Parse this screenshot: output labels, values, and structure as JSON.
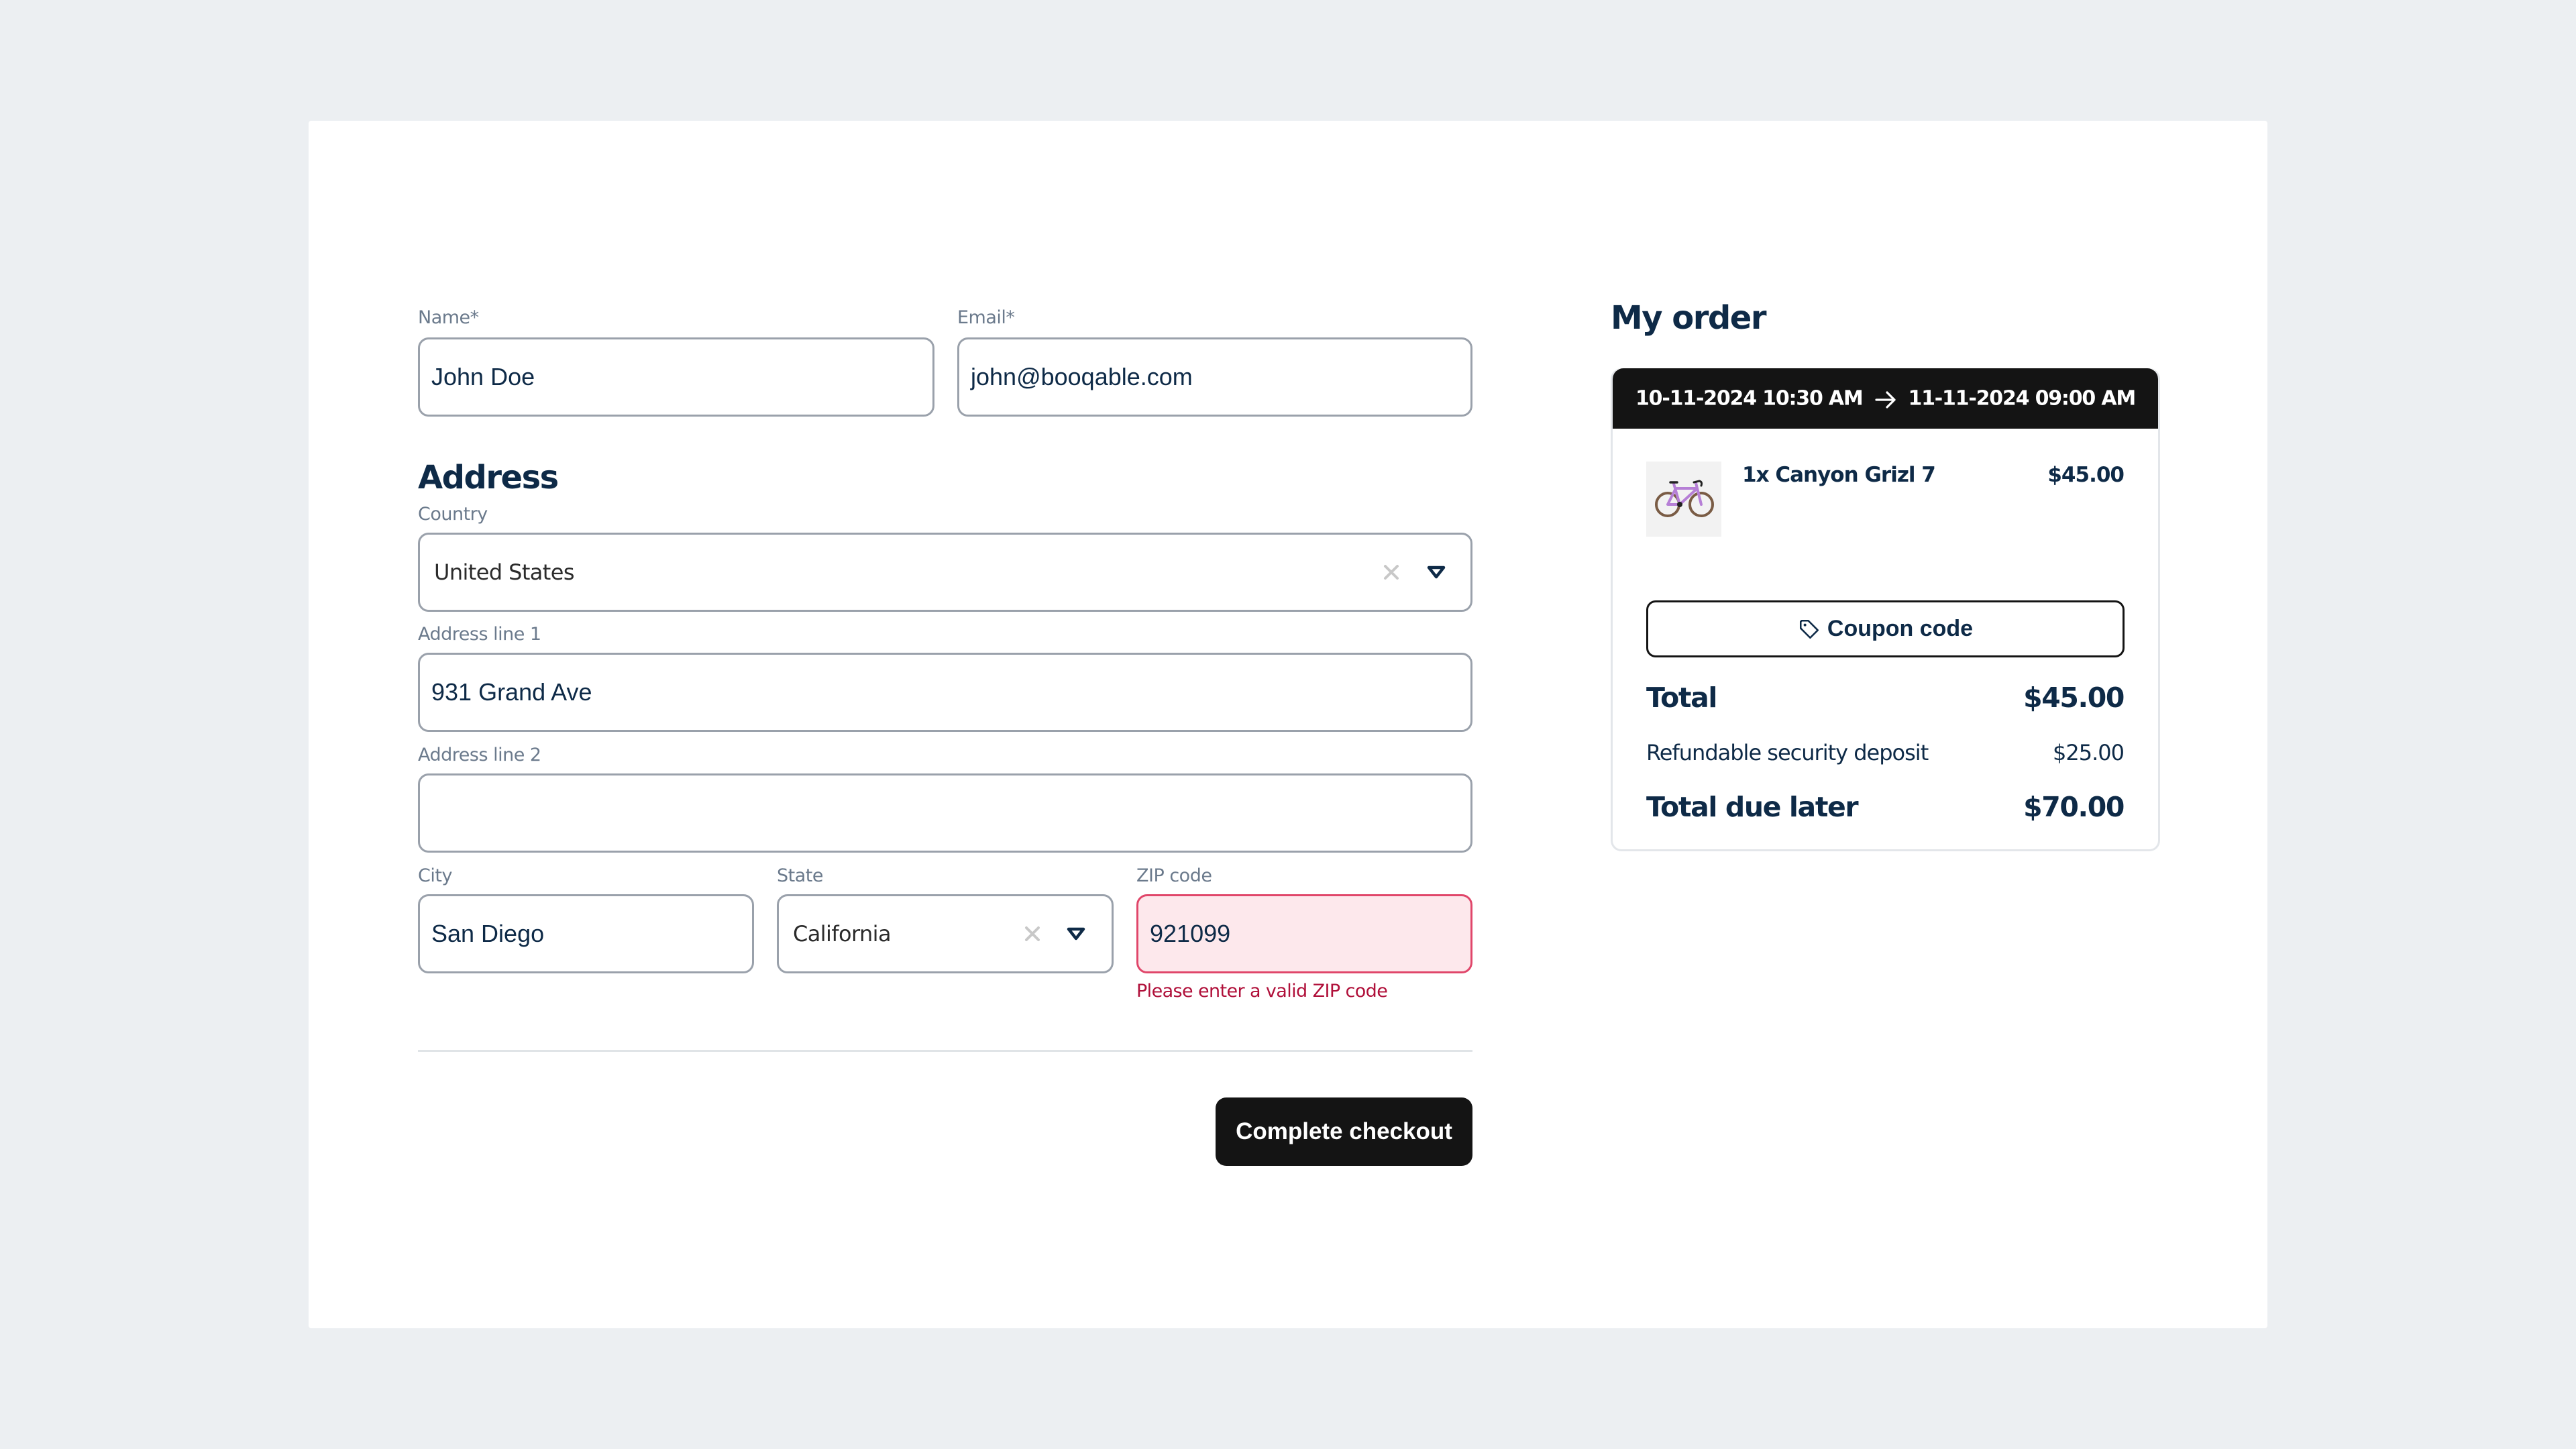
{
  "colors": {
    "page_background": "#ECEFF2",
    "card_background": "#FFFFFF",
    "text_primary": "#0E2A47",
    "label": "#6B7A8C",
    "input_border": "#9AA1AB",
    "error_border": "#E0466A",
    "error_background": "#FDE8EC",
    "error_text": "#B0103A",
    "button_dark": "#141414"
  },
  "form": {
    "name": {
      "label": "Name*",
      "value": "John Doe"
    },
    "email": {
      "label": "Email*",
      "value": "john@booqable.com"
    },
    "address_heading": "Address",
    "country": {
      "label": "Country",
      "value": "United States",
      "icons": [
        "clear-icon",
        "chevron-down-icon"
      ]
    },
    "address_line_1": {
      "label": "Address line 1",
      "value": "931 Grand Ave"
    },
    "address_line_2": {
      "label": "Address line 2",
      "value": ""
    },
    "city": {
      "label": "City",
      "value": "San Diego"
    },
    "state": {
      "label": "State",
      "value": "California",
      "icons": [
        "clear-icon",
        "chevron-down-icon"
      ]
    },
    "zip": {
      "label": "ZIP code",
      "value": "921099",
      "error": "Please enter a valid ZIP code",
      "invalid": true
    },
    "submit_label": "Complete checkout"
  },
  "order": {
    "title": "My order",
    "period": {
      "start": "10-11-2024 10:30 AM",
      "arrow_icon": "arrow-right-icon",
      "end": "11-11-2024 09:00 AM"
    },
    "items": [
      {
        "quantity_name": "1x Canyon Grizl 7",
        "price": "$45.00",
        "image": "bicycle-image"
      }
    ],
    "coupon": {
      "icon": "tag-icon",
      "label": "Coupon code"
    },
    "summary": {
      "total_label": "Total",
      "total_value": "$45.00",
      "deposit_label": "Refundable security deposit",
      "deposit_value": "$25.00",
      "due_later_label": "Total due later",
      "due_later_value": "$70.00"
    }
  }
}
